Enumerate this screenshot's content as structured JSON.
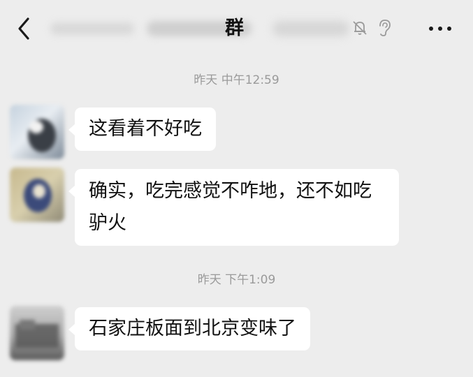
{
  "header": {
    "title": "群",
    "back_icon": "chevron-left-icon",
    "mute_icon": "bell-off-icon",
    "ear_icon": "ear-icon",
    "more_icon": "more-horizontal-icon"
  },
  "messages": [
    {
      "type": "timestamp",
      "text": "昨天 中午12:59"
    },
    {
      "type": "message",
      "text": "这看着不好吃"
    },
    {
      "type": "message",
      "text": "确实，吃完感觉不咋地，还不如吃驴火"
    },
    {
      "type": "timestamp",
      "text": "昨天 下午1:09"
    },
    {
      "type": "message",
      "text": "石家庄板面到北京变味了"
    }
  ]
}
